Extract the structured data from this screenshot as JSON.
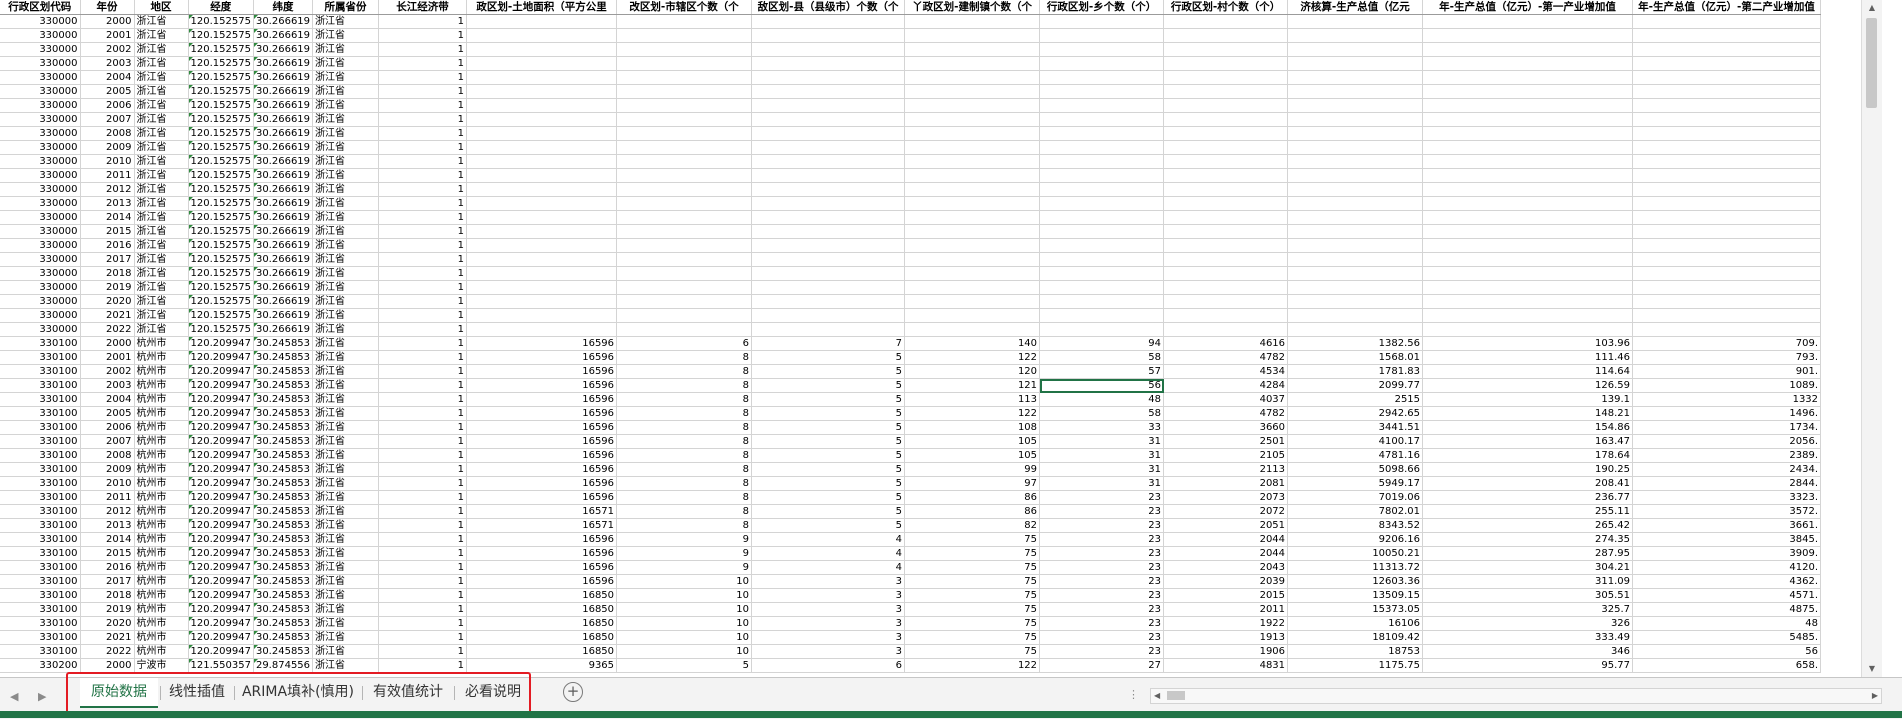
{
  "headers": [
    "行政区划代码",
    "年份",
    "地区",
    "经度",
    "纬度",
    "所属省份",
    "长江经济带",
    "政区划-土地面积（平方公里",
    "改区划-市辖区个数（个",
    "敌区划-县（县级市）个数（个",
    "丫政区划-建制镇个数（个",
    "行政区划-乡个数（个）",
    "行政区划-村个数（个）",
    "济核算-生产总值（亿元",
    "年-生产总值（亿元）-第一产业增加值",
    "年-生产总值（亿元）-第二产业增加值"
  ],
  "rows": [
    [
      "330000",
      "2000",
      "浙江省",
      "120.152575",
      "30.266619",
      "浙江省",
      "1",
      "",
      "",
      "",
      "",
      "",
      "",
      "",
      "",
      ""
    ],
    [
      "330000",
      "2001",
      "浙江省",
      "120.152575",
      "30.266619",
      "浙江省",
      "1",
      "",
      "",
      "",
      "",
      "",
      "",
      "",
      "",
      ""
    ],
    [
      "330000",
      "2002",
      "浙江省",
      "120.152575",
      "30.266619",
      "浙江省",
      "1",
      "",
      "",
      "",
      "",
      "",
      "",
      "",
      "",
      ""
    ],
    [
      "330000",
      "2003",
      "浙江省",
      "120.152575",
      "30.266619",
      "浙江省",
      "1",
      "",
      "",
      "",
      "",
      "",
      "",
      "",
      "",
      ""
    ],
    [
      "330000",
      "2004",
      "浙江省",
      "120.152575",
      "30.266619",
      "浙江省",
      "1",
      "",
      "",
      "",
      "",
      "",
      "",
      "",
      "",
      ""
    ],
    [
      "330000",
      "2005",
      "浙江省",
      "120.152575",
      "30.266619",
      "浙江省",
      "1",
      "",
      "",
      "",
      "",
      "",
      "",
      "",
      "",
      ""
    ],
    [
      "330000",
      "2006",
      "浙江省",
      "120.152575",
      "30.266619",
      "浙江省",
      "1",
      "",
      "",
      "",
      "",
      "",
      "",
      "",
      "",
      ""
    ],
    [
      "330000",
      "2007",
      "浙江省",
      "120.152575",
      "30.266619",
      "浙江省",
      "1",
      "",
      "",
      "",
      "",
      "",
      "",
      "",
      "",
      ""
    ],
    [
      "330000",
      "2008",
      "浙江省",
      "120.152575",
      "30.266619",
      "浙江省",
      "1",
      "",
      "",
      "",
      "",
      "",
      "",
      "",
      "",
      ""
    ],
    [
      "330000",
      "2009",
      "浙江省",
      "120.152575",
      "30.266619",
      "浙江省",
      "1",
      "",
      "",
      "",
      "",
      "",
      "",
      "",
      "",
      ""
    ],
    [
      "330000",
      "2010",
      "浙江省",
      "120.152575",
      "30.266619",
      "浙江省",
      "1",
      "",
      "",
      "",
      "",
      "",
      "",
      "",
      "",
      ""
    ],
    [
      "330000",
      "2011",
      "浙江省",
      "120.152575",
      "30.266619",
      "浙江省",
      "1",
      "",
      "",
      "",
      "",
      "",
      "",
      "",
      "",
      ""
    ],
    [
      "330000",
      "2012",
      "浙江省",
      "120.152575",
      "30.266619",
      "浙江省",
      "1",
      "",
      "",
      "",
      "",
      "",
      "",
      "",
      "",
      ""
    ],
    [
      "330000",
      "2013",
      "浙江省",
      "120.152575",
      "30.266619",
      "浙江省",
      "1",
      "",
      "",
      "",
      "",
      "",
      "",
      "",
      "",
      ""
    ],
    [
      "330000",
      "2014",
      "浙江省",
      "120.152575",
      "30.266619",
      "浙江省",
      "1",
      "",
      "",
      "",
      "",
      "",
      "",
      "",
      "",
      ""
    ],
    [
      "330000",
      "2015",
      "浙江省",
      "120.152575",
      "30.266619",
      "浙江省",
      "1",
      "",
      "",
      "",
      "",
      "",
      "",
      "",
      "",
      ""
    ],
    [
      "330000",
      "2016",
      "浙江省",
      "120.152575",
      "30.266619",
      "浙江省",
      "1",
      "",
      "",
      "",
      "",
      "",
      "",
      "",
      "",
      ""
    ],
    [
      "330000",
      "2017",
      "浙江省",
      "120.152575",
      "30.266619",
      "浙江省",
      "1",
      "",
      "",
      "",
      "",
      "",
      "",
      "",
      "",
      ""
    ],
    [
      "330000",
      "2018",
      "浙江省",
      "120.152575",
      "30.266619",
      "浙江省",
      "1",
      "",
      "",
      "",
      "",
      "",
      "",
      "",
      "",
      ""
    ],
    [
      "330000",
      "2019",
      "浙江省",
      "120.152575",
      "30.266619",
      "浙江省",
      "1",
      "",
      "",
      "",
      "",
      "",
      "",
      "",
      "",
      ""
    ],
    [
      "330000",
      "2020",
      "浙江省",
      "120.152575",
      "30.266619",
      "浙江省",
      "1",
      "",
      "",
      "",
      "",
      "",
      "",
      "",
      "",
      ""
    ],
    [
      "330000",
      "2021",
      "浙江省",
      "120.152575",
      "30.266619",
      "浙江省",
      "1",
      "",
      "",
      "",
      "",
      "",
      "",
      "",
      "",
      ""
    ],
    [
      "330000",
      "2022",
      "浙江省",
      "120.152575",
      "30.266619",
      "浙江省",
      "1",
      "",
      "",
      "",
      "",
      "",
      "",
      "",
      "",
      ""
    ],
    [
      "330100",
      "2000",
      "杭州市",
      "120.209947",
      "30.245853",
      "浙江省",
      "1",
      "16596",
      "6",
      "7",
      "140",
      "94",
      "4616",
      "1382.56",
      "103.96",
      "709."
    ],
    [
      "330100",
      "2001",
      "杭州市",
      "120.209947",
      "30.245853",
      "浙江省",
      "1",
      "16596",
      "8",
      "5",
      "122",
      "58",
      "4782",
      "1568.01",
      "111.46",
      "793."
    ],
    [
      "330100",
      "2002",
      "杭州市",
      "120.209947",
      "30.245853",
      "浙江省",
      "1",
      "16596",
      "8",
      "5",
      "120",
      "57",
      "4534",
      "1781.83",
      "114.64",
      "901."
    ],
    [
      "330100",
      "2003",
      "杭州市",
      "120.209947",
      "30.245853",
      "浙江省",
      "1",
      "16596",
      "8",
      "5",
      "121",
      "56",
      "4284",
      "2099.77",
      "126.59",
      "1089."
    ],
    [
      "330100",
      "2004",
      "杭州市",
      "120.209947",
      "30.245853",
      "浙江省",
      "1",
      "16596",
      "8",
      "5",
      "113",
      "48",
      "4037",
      "2515",
      "139.1",
      "1332"
    ],
    [
      "330100",
      "2005",
      "杭州市",
      "120.209947",
      "30.245853",
      "浙江省",
      "1",
      "16596",
      "8",
      "5",
      "122",
      "58",
      "4782",
      "2942.65",
      "148.21",
      "1496."
    ],
    [
      "330100",
      "2006",
      "杭州市",
      "120.209947",
      "30.245853",
      "浙江省",
      "1",
      "16596",
      "8",
      "5",
      "108",
      "33",
      "3660",
      "3441.51",
      "154.86",
      "1734."
    ],
    [
      "330100",
      "2007",
      "杭州市",
      "120.209947",
      "30.245853",
      "浙江省",
      "1",
      "16596",
      "8",
      "5",
      "105",
      "31",
      "2501",
      "4100.17",
      "163.47",
      "2056."
    ],
    [
      "330100",
      "2008",
      "杭州市",
      "120.209947",
      "30.245853",
      "浙江省",
      "1",
      "16596",
      "8",
      "5",
      "105",
      "31",
      "2105",
      "4781.16",
      "178.64",
      "2389."
    ],
    [
      "330100",
      "2009",
      "杭州市",
      "120.209947",
      "30.245853",
      "浙江省",
      "1",
      "16596",
      "8",
      "5",
      "99",
      "31",
      "2113",
      "5098.66",
      "190.25",
      "2434."
    ],
    [
      "330100",
      "2010",
      "杭州市",
      "120.209947",
      "30.245853",
      "浙江省",
      "1",
      "16596",
      "8",
      "5",
      "97",
      "31",
      "2081",
      "5949.17",
      "208.41",
      "2844."
    ],
    [
      "330100",
      "2011",
      "杭州市",
      "120.209947",
      "30.245853",
      "浙江省",
      "1",
      "16596",
      "8",
      "5",
      "86",
      "23",
      "2073",
      "7019.06",
      "236.77",
      "3323."
    ],
    [
      "330100",
      "2012",
      "杭州市",
      "120.209947",
      "30.245853",
      "浙江省",
      "1",
      "16571",
      "8",
      "5",
      "86",
      "23",
      "2072",
      "7802.01",
      "255.11",
      "3572."
    ],
    [
      "330100",
      "2013",
      "杭州市",
      "120.209947",
      "30.245853",
      "浙江省",
      "1",
      "16571",
      "8",
      "5",
      "82",
      "23",
      "2051",
      "8343.52",
      "265.42",
      "3661."
    ],
    [
      "330100",
      "2014",
      "杭州市",
      "120.209947",
      "30.245853",
      "浙江省",
      "1",
      "16596",
      "9",
      "4",
      "75",
      "23",
      "2044",
      "9206.16",
      "274.35",
      "3845."
    ],
    [
      "330100",
      "2015",
      "杭州市",
      "120.209947",
      "30.245853",
      "浙江省",
      "1",
      "16596",
      "9",
      "4",
      "75",
      "23",
      "2044",
      "10050.21",
      "287.95",
      "3909."
    ],
    [
      "330100",
      "2016",
      "杭州市",
      "120.209947",
      "30.245853",
      "浙江省",
      "1",
      "16596",
      "9",
      "4",
      "75",
      "23",
      "2043",
      "11313.72",
      "304.21",
      "4120."
    ],
    [
      "330100",
      "2017",
      "杭州市",
      "120.209947",
      "30.245853",
      "浙江省",
      "1",
      "16596",
      "10",
      "3",
      "75",
      "23",
      "2039",
      "12603.36",
      "311.09",
      "4362."
    ],
    [
      "330100",
      "2018",
      "杭州市",
      "120.209947",
      "30.245853",
      "浙江省",
      "1",
      "16850",
      "10",
      "3",
      "75",
      "23",
      "2015",
      "13509.15",
      "305.51",
      "4571."
    ],
    [
      "330100",
      "2019",
      "杭州市",
      "120.209947",
      "30.245853",
      "浙江省",
      "1",
      "16850",
      "10",
      "3",
      "75",
      "23",
      "2011",
      "15373.05",
      "325.7",
      "4875."
    ],
    [
      "330100",
      "2020",
      "杭州市",
      "120.209947",
      "30.245853",
      "浙江省",
      "1",
      "16850",
      "10",
      "3",
      "75",
      "23",
      "1922",
      "16106",
      "326",
      "48"
    ],
    [
      "330100",
      "2021",
      "杭州市",
      "120.209947",
      "30.245853",
      "浙江省",
      "1",
      "16850",
      "10",
      "3",
      "75",
      "23",
      "1913",
      "18109.42",
      "333.49",
      "5485."
    ],
    [
      "330100",
      "2022",
      "杭州市",
      "120.209947",
      "30.245853",
      "浙江省",
      "1",
      "16850",
      "10",
      "3",
      "75",
      "23",
      "1906",
      "18753",
      "346",
      "56"
    ],
    [
      "330200",
      "2000",
      "宁波市",
      "121.550357",
      "29.874556",
      "浙江省",
      "1",
      "9365",
      "5",
      "6",
      "122",
      "27",
      "4831",
      "1175.75",
      "95.77",
      "658."
    ]
  ],
  "tabs": [
    "原始数据",
    "线性插值",
    "ARIMA填补(慎用)",
    "有效值统计",
    "必看说明"
  ],
  "active_tab": "原始数据",
  "colors": {
    "accent": "#217346",
    "highlight": "#e31b23",
    "gridline": "#d4d4d4"
  },
  "icons": [
    "add-sheet-icon",
    "scroll-left-icon",
    "scroll-right-icon",
    "scroll-up-icon",
    "scroll-down-icon"
  ]
}
